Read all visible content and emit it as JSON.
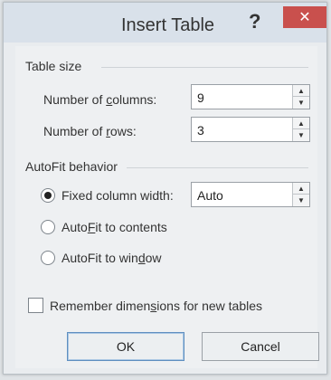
{
  "dialog": {
    "title": "Insert Table",
    "help_label": "?",
    "close_label": "✕"
  },
  "table_size": {
    "heading": "Table size",
    "columns": {
      "label_pre": "Number of ",
      "label_key": "c",
      "label_post": "olumns:",
      "value": "9"
    },
    "rows": {
      "label_pre": "Number of ",
      "label_key": "r",
      "label_post": "ows:",
      "value": "3"
    }
  },
  "autofit": {
    "heading": "AutoFit behavior",
    "options": [
      {
        "label_pre": "",
        "label_key": "",
        "label_post": "Fixed column width:",
        "selected": true
      },
      {
        "label_pre": "Auto",
        "label_key": "F",
        "label_post": "it to contents",
        "selected": false
      },
      {
        "label_pre": "AutoFit to win",
        "label_key": "d",
        "label_post": "ow",
        "selected": false
      }
    ],
    "fixed_width_value": "Auto"
  },
  "remember": {
    "label_pre": "Remember dimen",
    "label_key": "s",
    "label_post": "ions for new tables",
    "checked": false
  },
  "buttons": {
    "ok": "OK",
    "cancel": "Cancel"
  }
}
